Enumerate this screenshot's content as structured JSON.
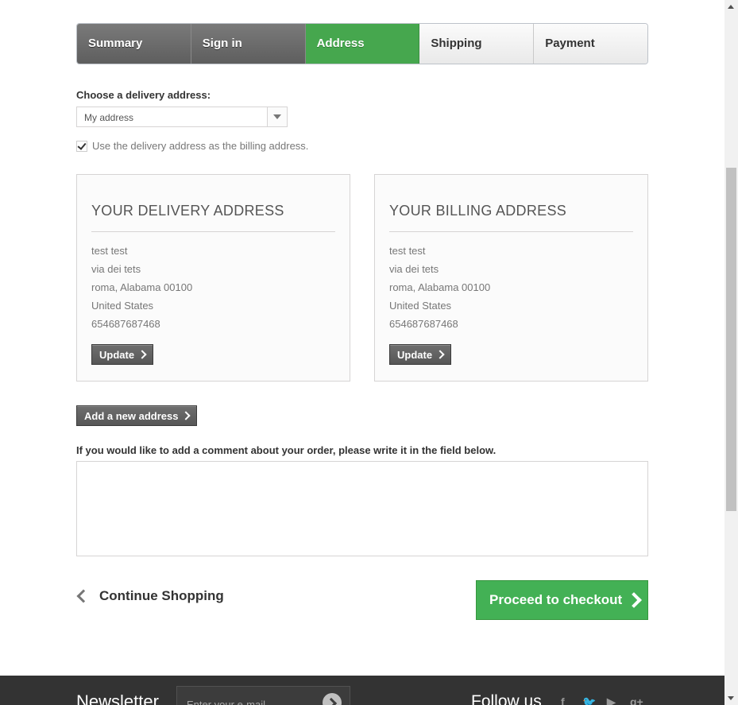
{
  "steps": [
    {
      "label": "Summary",
      "state": "done"
    },
    {
      "label": "Sign in",
      "state": "done"
    },
    {
      "label": "Address",
      "state": "current"
    },
    {
      "label": "Shipping",
      "state": "todo"
    },
    {
      "label": "Payment",
      "state": "todo"
    }
  ],
  "delivery_choice": {
    "label": "Choose a delivery address:",
    "selected": "My address",
    "use_as_billing_label": "Use the delivery address as the billing address.",
    "use_as_billing_checked": true
  },
  "delivery_address": {
    "title": "YOUR DELIVERY ADDRESS",
    "lines": [
      "test test",
      "via dei tets",
      "roma, Alabama 00100",
      "United States",
      "654687687468"
    ],
    "update_label": "Update"
  },
  "billing_address": {
    "title": "YOUR BILLING ADDRESS",
    "lines": [
      "test test",
      "via dei tets",
      "roma, Alabama 00100",
      "United States",
      "654687687468"
    ],
    "update_label": "Update"
  },
  "add_address_label": "Add a new address",
  "comment": {
    "label": "If you would like to add a comment about your order, please write it in the field below.",
    "value": ""
  },
  "nav": {
    "continue_label": "Continue Shopping",
    "proceed_label": "Proceed to checkout"
  },
  "footer": {
    "newsletter_title": "Newsletter",
    "newsletter_placeholder": "Enter your e-mail",
    "follow_title": "Follow us",
    "social_icons": [
      "facebook-icon",
      "twitter-icon",
      "youtube-icon",
      "google-plus-icon"
    ]
  },
  "colors": {
    "accent_green": "#46a74e",
    "dark_button": "#5e5e5e",
    "footer_bg": "#333333"
  }
}
